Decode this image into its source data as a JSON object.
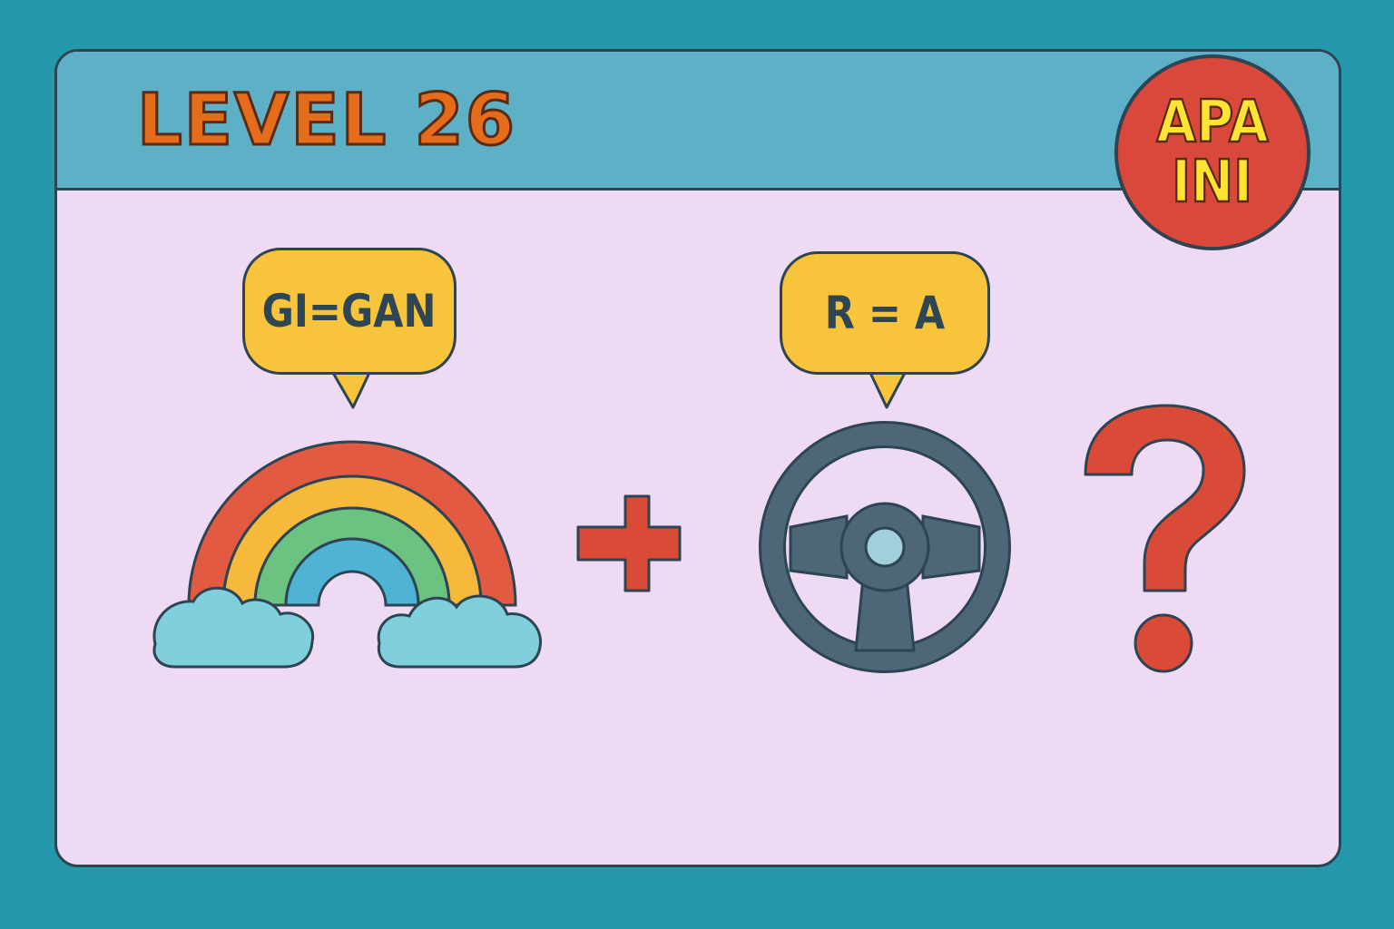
{
  "header": {
    "level_title": "LEVEL 26"
  },
  "badge": {
    "line1": "APA",
    "line2": "INI"
  },
  "puzzle": {
    "clue_1": "GI=GAN",
    "clue_2": "R = A",
    "operator": "plus-icon",
    "unknown": "question-mark-icon",
    "picture_1": "rainbow-icon",
    "picture_2": "steering-wheel-icon"
  },
  "colors": {
    "background": "#2499ab",
    "card": "#efdaf3",
    "header": "#5db0c6",
    "title": "#e56c1b",
    "badge": "#d9483a",
    "badge_text": "#ffe433",
    "bubble": "#f8c43c",
    "outline": "#2d4452",
    "accent_red": "#d94a37"
  }
}
